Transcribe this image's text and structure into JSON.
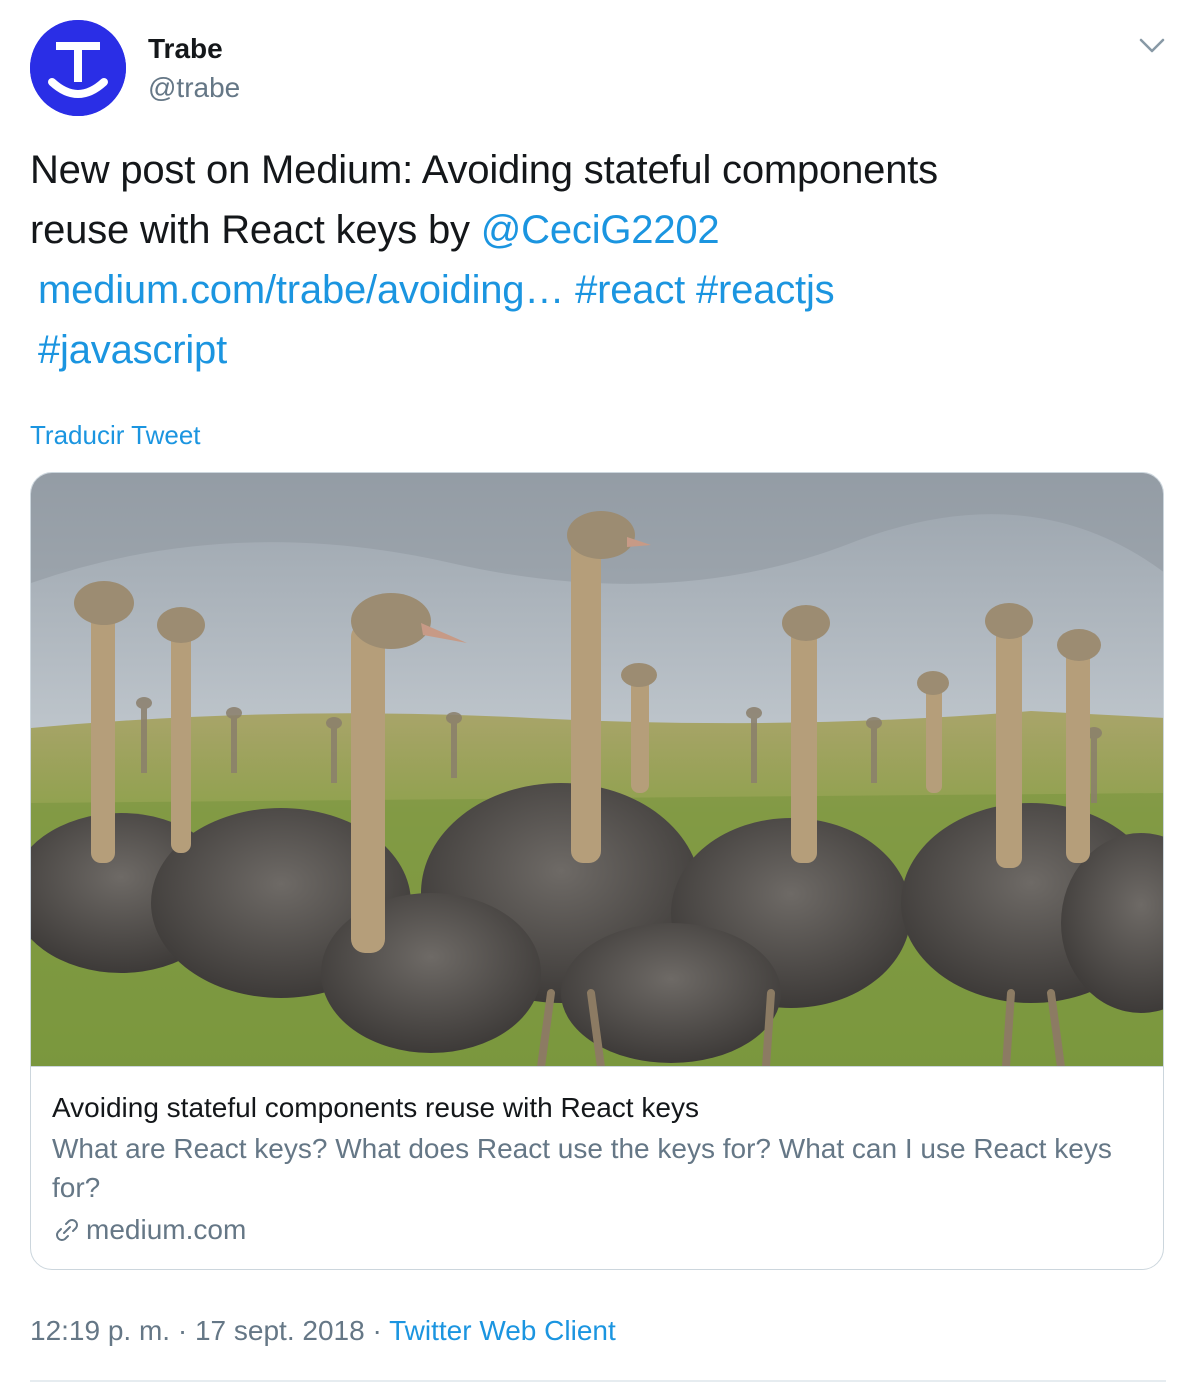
{
  "author": {
    "display_name": "Trabe",
    "handle": "@trabe",
    "avatar_icon": "trabe-logo-icon",
    "avatar_color": "#2a2ee6"
  },
  "tweet": {
    "text_line1": "New post on Medium: Avoiding stateful components",
    "text_line2_prefix": "reuse with React keys by ",
    "mention": "@CeciG2202",
    "url": "medium.com/trabe/avoiding…",
    "hashtag_react": "#react",
    "hashtag_reactjs": "#reactjs",
    "hashtag_javascript": "#javascript",
    "link_color": "#1b95e0"
  },
  "translate_label": "Traducir Tweet",
  "card": {
    "image_icon": "ostriches-photo",
    "title": "Avoiding stateful components reuse with React keys",
    "description": "What are React keys? What does React use the keys for? What can I use React keys for?",
    "domain_icon": "link-icon",
    "domain": "medium.com"
  },
  "meta": {
    "time": "12:19 p. m.",
    "separator": "·",
    "date": "17 sept. 2018",
    "client": "Twitter Web Client"
  },
  "menu_icon": "chevron-down-icon"
}
